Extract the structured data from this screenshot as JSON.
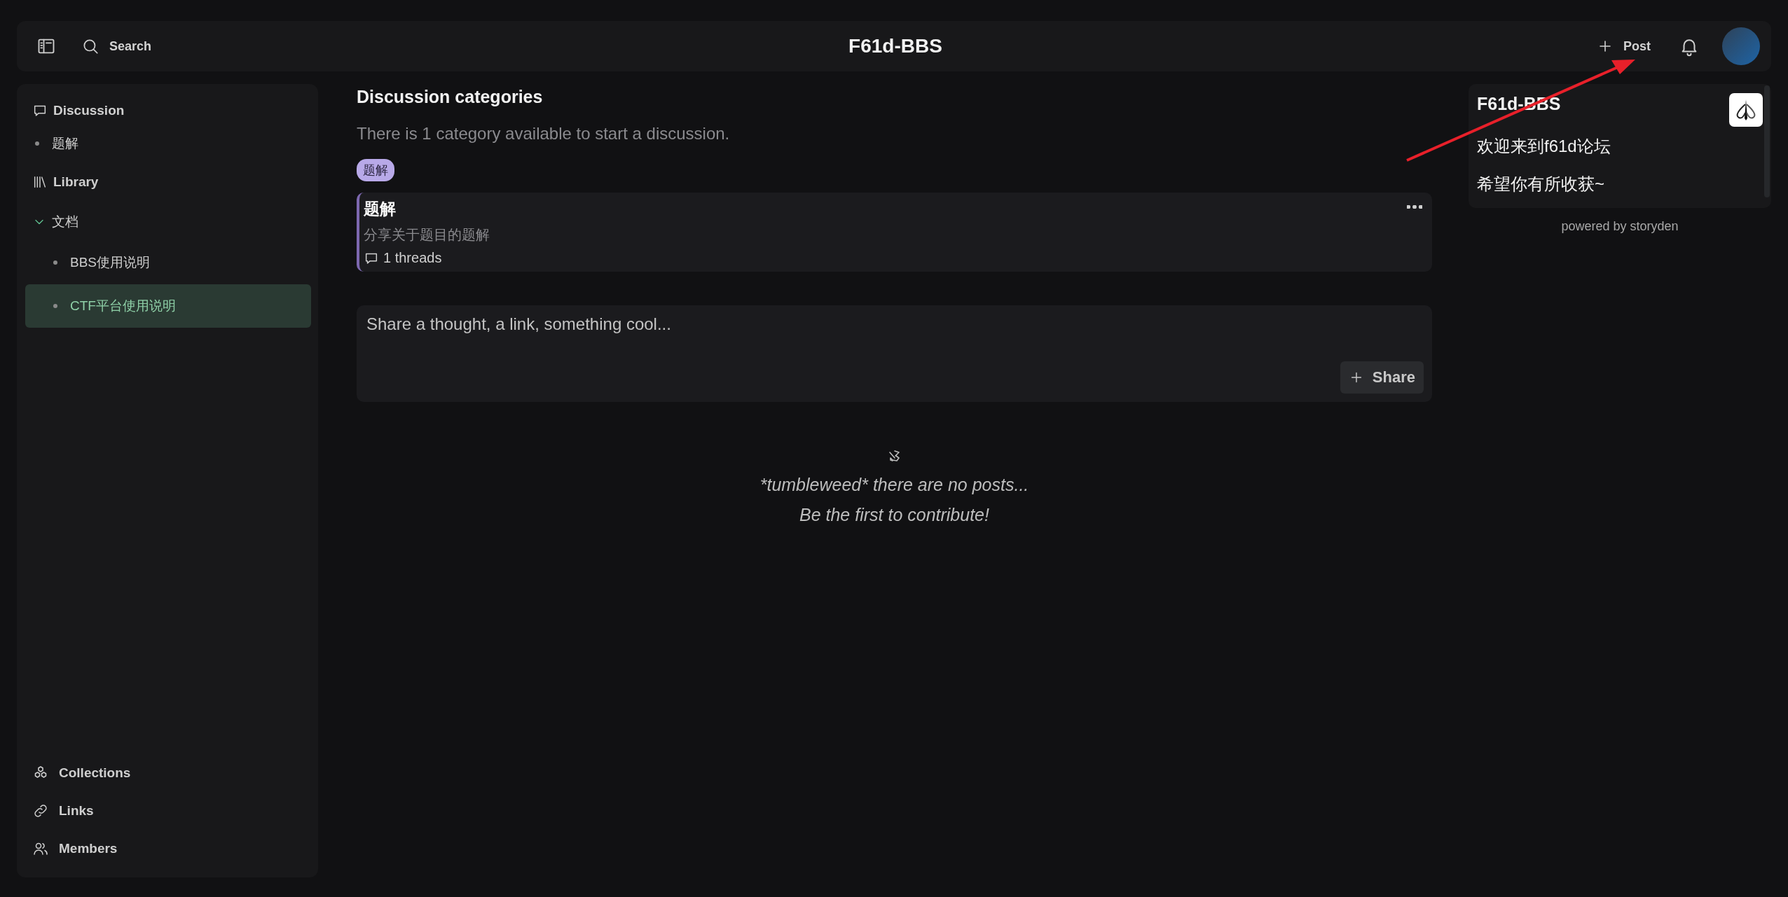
{
  "header": {
    "search_label": "Search",
    "title": "F61d-BBS",
    "post_button": "Post"
  },
  "sidebar": {
    "discussion": {
      "label": "Discussion",
      "children": [
        {
          "label": "题解",
          "selected": false
        }
      ]
    },
    "library": {
      "label": "Library",
      "children": [
        {
          "label": "文档",
          "expanded": true,
          "children": [
            {
              "label": "BBS使用说明",
              "selected": false
            },
            {
              "label": "CTF平台使用说明",
              "selected": true
            }
          ]
        }
      ]
    },
    "footer_links": [
      {
        "label": "Collections"
      },
      {
        "label": "Links"
      },
      {
        "label": "Members"
      }
    ]
  },
  "main": {
    "title": "Discussion categories",
    "subtitle": "There is 1 category available to start a discussion.",
    "tags": [
      {
        "label": "题解",
        "color": "#b8a9e8"
      }
    ],
    "categories": [
      {
        "title": "题解",
        "description": "分享关于题目的题解",
        "threads": "1 threads",
        "color": "#7d68b0"
      }
    ],
    "composer": {
      "placeholder": "Share a thought, a link, something cool...",
      "button": "Share"
    },
    "empty_state": {
      "lines": [
        "*tumbleweed* there are no posts...",
        "Be the first to contribute!"
      ]
    }
  },
  "aside": {
    "title": "F61d-BBS",
    "lines": [
      "欢迎来到f61d论坛",
      "希望你有所收获~"
    ],
    "footer": "powered by storyden"
  },
  "annotation": {
    "kind": "arrow"
  }
}
